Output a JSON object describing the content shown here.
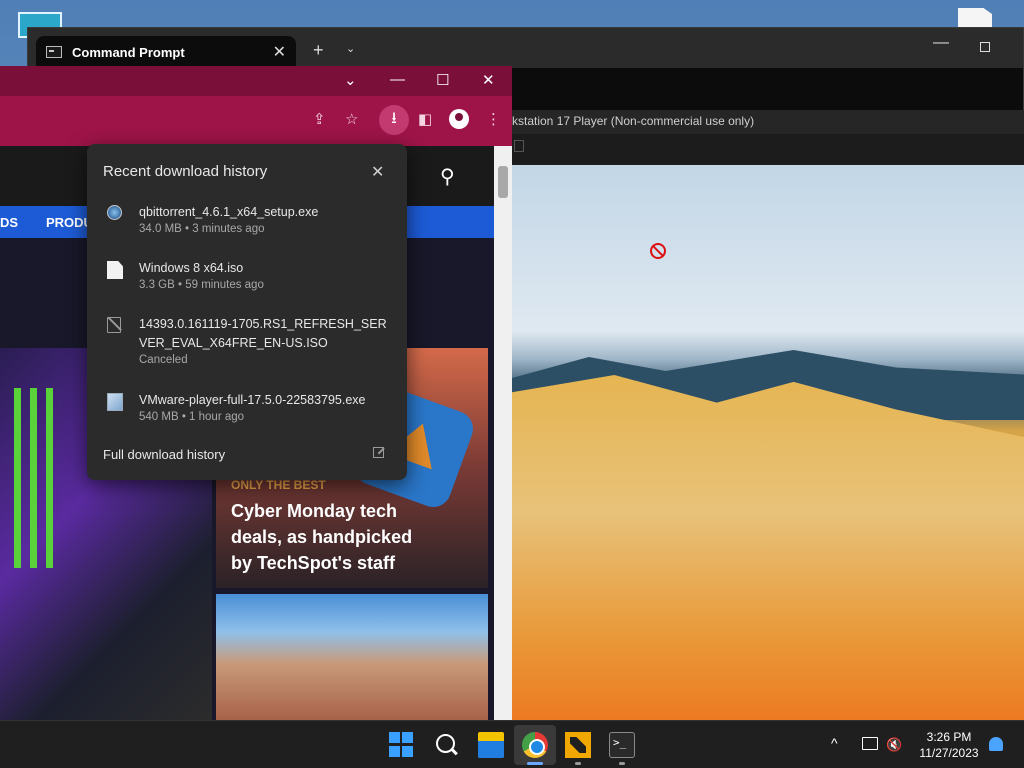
{
  "terminal": {
    "tab_title": "Command Prompt",
    "tab_close": "✕",
    "new_tab": "+",
    "dropdown": "⌄",
    "minimize": "—"
  },
  "vmware": {
    "title": "kstation 17 Player (Non-commercial use only)"
  },
  "chrome": {
    "dropdown": "⌄",
    "minimize": "—",
    "maximize": "☐",
    "close": "✕",
    "toolbar": {
      "share": "⇪",
      "bookmark": "☆",
      "download": "⭳",
      "sidepanel": "◧",
      "menu": "⋮"
    }
  },
  "site": {
    "nav": [
      "DS",
      "PRODU"
    ],
    "promo": {
      "kicker": "ONLY THE BEST",
      "title": "Cyber Monday tech deals, as handpicked by TechSpot's staff"
    }
  },
  "downloads": {
    "header": "Recent download history",
    "close": "✕",
    "items": [
      {
        "name": "qbittorrent_4.6.1_x64_setup.exe",
        "meta": "34.0 MB • 3 minutes ago",
        "icon": "qbittorrent-icon"
      },
      {
        "name": "Windows 8 x64.iso",
        "meta": "3.3 GB • 59 minutes ago",
        "icon": "file-icon"
      },
      {
        "name": "14393.0.161119-1705.RS1_REFRESH_SERVER_EVAL_X64FRE_EN-US.ISO",
        "meta": "Canceled",
        "icon": "canceled-file-icon"
      },
      {
        "name": "VMware-player-full-17.5.0-22583795.exe",
        "meta": "540 MB • 1 hour ago",
        "icon": "installer-icon"
      }
    ],
    "footer": "Full download history"
  },
  "taskbar": {
    "time": "3:26 PM",
    "date": "11/27/2023",
    "chevron": "^"
  }
}
